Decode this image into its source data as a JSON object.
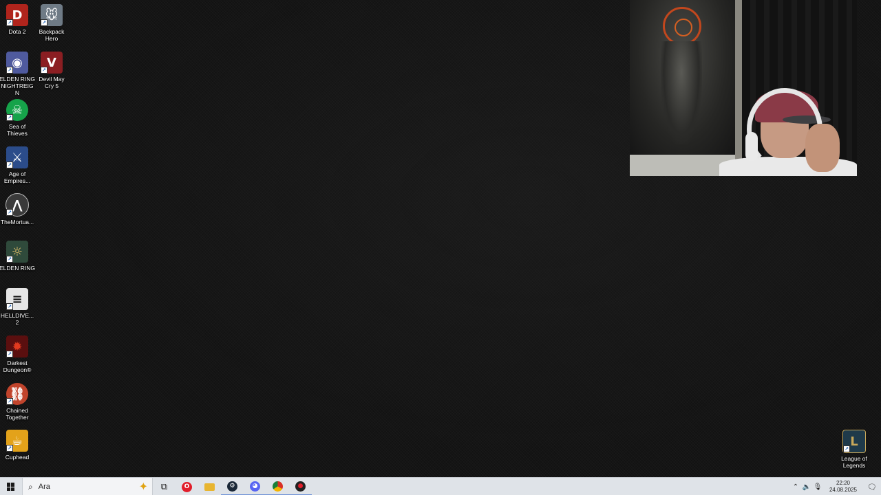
{
  "desktop": {
    "icons": [
      {
        "label": "Dota 2",
        "icon": "dota2-icon",
        "color": "#b0241c",
        "glyph": "D"
      },
      {
        "label": "Backpack Hero",
        "icon": "backpack-hero-icon",
        "color": "#6f7b86",
        "glyph": "🐭"
      },
      {
        "label": "ELDEN RING NIGHTREIGN",
        "icon": "elden-ring-nightreign-icon",
        "color": "#4f5a9e",
        "glyph": "◉"
      },
      {
        "label": "Devil May Cry 5",
        "icon": "devil-may-cry-5-icon",
        "color": "#8b1e22",
        "glyph": "V"
      },
      {
        "label": "Sea of Thieves",
        "icon": "sea-of-thieves-icon",
        "color": "#16a34a",
        "glyph": "☠"
      },
      {
        "label": "Age of Empires...",
        "icon": "age-of-empires-icon",
        "color": "#2b4c8a",
        "glyph": "⚔"
      },
      {
        "label": "TheMortua...",
        "icon": "the-mortuary-assistant-icon",
        "color": "#3a3a3a",
        "glyph": "⋀"
      },
      {
        "label": "ELDEN RING",
        "icon": "elden-ring-icon",
        "color": "#2f4a3b",
        "glyph": "☼"
      },
      {
        "label": "HELLDIVE... 2",
        "icon": "helldivers-2-icon",
        "color": "#e6e6e6",
        "glyph": "≡"
      },
      {
        "label": "Darkest Dungeon®",
        "icon": "darkest-dungeon-icon",
        "color": "#5a0f0f",
        "glyph": "✹"
      },
      {
        "label": "Chained Together",
        "icon": "chained-together-icon",
        "color": "#c1442c",
        "glyph": "⛓"
      },
      {
        "label": "Cuphead",
        "icon": "cuphead-icon",
        "color": "#e3a21a",
        "glyph": "☕"
      },
      {
        "label": "League of Legends",
        "icon": "league-of-legends-icon",
        "color": "#1f3a4a",
        "glyph": "L"
      }
    ]
  },
  "taskbar": {
    "search_placeholder": "Ara",
    "apps": [
      {
        "name": "task-view",
        "icon": "task-view-icon",
        "glyph": "⧉",
        "color": "#222222"
      },
      {
        "name": "opera",
        "icon": "opera-icon",
        "glyph": "O",
        "color": "#e11d2a"
      },
      {
        "name": "file-explorer",
        "icon": "folder-icon",
        "glyph": "▬",
        "color": "#e8b530"
      },
      {
        "name": "steam",
        "icon": "steam-icon",
        "glyph": "⚙",
        "color": "#1b2838"
      },
      {
        "name": "discord",
        "icon": "discord-icon",
        "glyph": "◕",
        "color": "#5865f2"
      },
      {
        "name": "chrome",
        "icon": "chrome-icon",
        "glyph": "◎",
        "color": "#2f9e44"
      },
      {
        "name": "recorder",
        "icon": "recorder-icon",
        "glyph": "●",
        "color": "#d21f1f"
      }
    ],
    "time": "22:20",
    "date": "24.08.2025"
  }
}
